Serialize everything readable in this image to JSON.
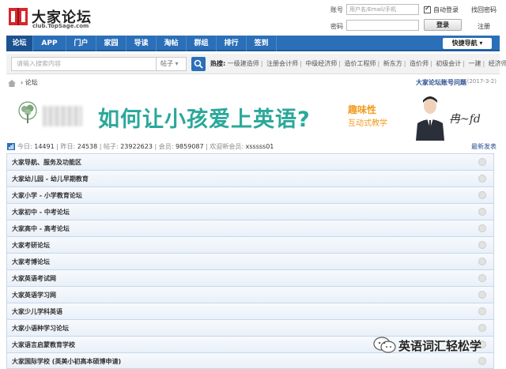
{
  "site": {
    "title": "大家论坛",
    "subtitle": "club.TopSage.com"
  },
  "login": {
    "account_label": "账号",
    "account_placeholder": "用户名/Email/手机",
    "auto_login_label": "自动登录",
    "recover_password": "找回密码",
    "password_label": "密码",
    "login_button": "登录",
    "register_link": "注册"
  },
  "nav": {
    "items": [
      "论坛",
      "APP",
      "门户",
      "家园",
      "导读",
      "淘帖",
      "群组",
      "排行",
      "签到"
    ],
    "quick_nav": "快捷导航"
  },
  "search": {
    "placeholder": "请输入搜索内容",
    "type": "帖子",
    "hot_label": "热搜:",
    "hot_terms": [
      "一级建造师",
      "注册会计师",
      "中级经济师",
      "造价工程师",
      "新东方",
      "造价师",
      "初级会计",
      "一建",
      "经济师"
    ]
  },
  "breadcrumb": {
    "current": "论坛",
    "notice": "大家论坛账号问题",
    "notice_date": "(2017-3-2)"
  },
  "banner": {
    "headline": "如何让小孩爱上英语?",
    "tag1": "趣味性",
    "tag2": "互动式教学"
  },
  "stats": {
    "today_label": "今日:",
    "today": "14491",
    "yesterday_label": "昨日:",
    "yesterday": "24538",
    "posts_label": "帖子:",
    "posts": "23922623",
    "members_label": "会员:",
    "members": "9859087",
    "newest_label": "欢迎新会员:",
    "newest": "xsssss01",
    "latest_link": "最新发表"
  },
  "forums": [
    "大家导航、服务及功能区",
    "大家幼儿园 - 幼儿早期教育",
    "大家小学 - 小学教育论坛",
    "大家初中 - 中考论坛",
    "大家高中 - 高考论坛",
    "大家考研论坛",
    "大家考博论坛",
    "大家英语考试网",
    "大家英语学习网",
    "大家少儿学科英语",
    "大家小语种学习论坛",
    "大家语言启蒙教育学校",
    "大家国际学校 (英美小初高本硕博申请)"
  ],
  "watermark": {
    "text": "英语词汇轻松学"
  },
  "colors": {
    "nav_blue": "#2a6fb8",
    "banner_teal": "#2aa89a",
    "banner_orange": "#f39a1e"
  }
}
